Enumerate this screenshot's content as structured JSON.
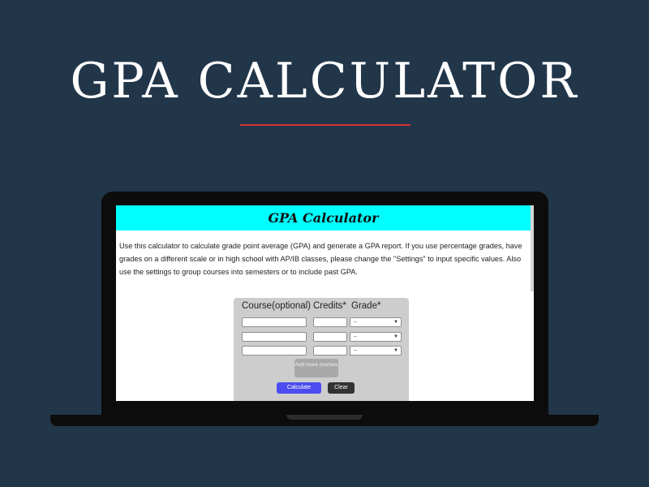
{
  "hero": {
    "title": "GPA CALCULATOR",
    "rule_color": "#d5343a"
  },
  "app": {
    "title": "GPA Calculator",
    "header_color": "#00ffff",
    "intro": "Use this calculator to calculate grade point average (GPA) and generate a GPA report. If you use percentage grades, have grades on a different scale or in high school with AP/IB classes, please change the \"Settings\" to input specific values. Also use the settings to group courses into semesters or to include past GPA."
  },
  "form": {
    "headers": {
      "course": "Course(optional)",
      "credits": "Credits*",
      "grade": "Grade*"
    },
    "rows": [
      {
        "course": "",
        "credits": "",
        "grade": "--"
      },
      {
        "course": "",
        "credits": "",
        "grade": "--"
      },
      {
        "course": "",
        "credits": "",
        "grade": "--"
      }
    ],
    "add_more_label": "Add more courses",
    "calculate_label": "Calculate",
    "clear_label": "Clear",
    "colors": {
      "calculate": "#4c4cf0",
      "clear": "#333333",
      "add_more": "#a9a9a9"
    }
  },
  "icons": {
    "dropdown": "chevron-down-icon"
  }
}
